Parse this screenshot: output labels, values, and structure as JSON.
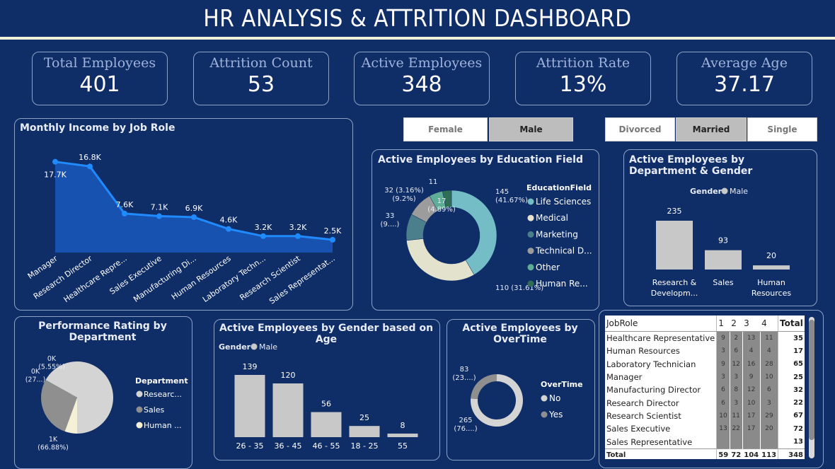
{
  "title": "HR ANALYSIS & ATTRITION DASHBOARD",
  "kpis": [
    {
      "label": "Total Employees",
      "value": "401"
    },
    {
      "label": "Attrition Count",
      "value": "53"
    },
    {
      "label": "Active Employees",
      "value": "348"
    },
    {
      "label": "Attrition Rate",
      "value": "13%"
    },
    {
      "label": "Average Age",
      "value": "37.17"
    }
  ],
  "slicers": {
    "gender": [
      {
        "label": "Female",
        "selected": false
      },
      {
        "label": "Male",
        "selected": true
      }
    ],
    "marital": [
      {
        "label": "Divorced",
        "selected": false
      },
      {
        "label": "Married",
        "selected": true
      },
      {
        "label": "Single",
        "selected": false
      }
    ]
  },
  "colors": {
    "background": "#0f2d66",
    "area": "#1a56b8",
    "line": "#1f8bff",
    "bar": "#c8c8c8"
  },
  "chart_data": [
    {
      "type": "area",
      "title": "Monthly Income by Job Role",
      "categories": [
        "Manager",
        "Research Director",
        "Healthcare Repre...",
        "Sales Executive",
        "Manufacturing Di...",
        "Human Resources",
        "Laboratory Techn...",
        "Research Scientist",
        "Sales Representat..."
      ],
      "values": [
        17.7,
        16.8,
        7.6,
        7.1,
        6.9,
        4.6,
        3.2,
        3.2,
        2.5
      ],
      "data_labels": [
        "17.7K",
        "16.8K",
        "7.6K",
        "7.1K",
        "6.9K",
        "4.6K",
        "3.2K",
        "3.2K",
        "2.5K"
      ],
      "ylim": [
        0,
        20
      ]
    },
    {
      "type": "pie",
      "title": "Active Employees by Education Field",
      "legend_title": "EducationField",
      "legend_position": "right",
      "slices": [
        {
          "name": "Life Sciences",
          "value": 145,
          "label": "145\n(41.67%)",
          "color": "#74bdc6"
        },
        {
          "name": "Medical",
          "value": 110,
          "label": "110 (31.61%)",
          "color": "#e3e2cc"
        },
        {
          "name": "Marketing",
          "value": 33,
          "label": "33\n(9....)",
          "color": "#4c7f8c"
        },
        {
          "name": "Technical D...",
          "value": 32,
          "label": "32 (3.16%)\n(9.2%)",
          "color": "#9c9c9c"
        },
        {
          "name": "Other",
          "value": 17,
          "label": "17\n(4.89%)",
          "color": "#5eae97"
        },
        {
          "name": "Human Re...",
          "value": 11,
          "label": "11",
          "color": "#2f6e55"
        }
      ]
    },
    {
      "type": "bar",
      "title": "Active Employees by Department & Gender",
      "legend_title": "Gender",
      "series": [
        {
          "name": "Male",
          "values": [
            235,
            93,
            20
          ]
        }
      ],
      "categories": [
        "Research & Developm...",
        "Sales",
        "Human Resources"
      ]
    },
    {
      "type": "pie",
      "title": "Performance Rating by Department",
      "legend_title": "Department",
      "slices": [
        {
          "name": "Researc...",
          "value": 66.88,
          "label": "1K\n(66.88%)",
          "color": "#d4d4d4"
        },
        {
          "name": "Sales",
          "value": 27.57,
          "label": "0K\n(27...)",
          "color": "#8f8f8f"
        },
        {
          "name": "Human ...",
          "value": 5.55,
          "label": "0K\n(5.55%)",
          "color": "#f5f1d7"
        }
      ]
    },
    {
      "type": "bar",
      "title": "Active Employees by Gender based on Age",
      "legend_title": "Gender",
      "series": [
        {
          "name": "Male",
          "values": [
            139,
            120,
            56,
            25,
            8
          ]
        }
      ],
      "categories": [
        "26 - 35",
        "36 - 45",
        "46 - 55",
        "18 - 25",
        "55"
      ]
    },
    {
      "type": "pie",
      "title": "Active Employees by OverTime",
      "legend_title": "OverTime",
      "slices": [
        {
          "name": "No",
          "value": 265,
          "label": "265\n(76....)",
          "color": "#d4d4d4"
        },
        {
          "name": "Yes",
          "value": 83,
          "label": "83\n(23....)",
          "color": "#8f8f8f"
        }
      ]
    },
    {
      "type": "table",
      "columns": [
        "JobRole",
        "1",
        "2",
        "3",
        "4",
        "Total"
      ],
      "rows": [
        [
          "Healthcare Representative",
          "9",
          "2",
          "13",
          "11",
          "35"
        ],
        [
          "Human Resources",
          "3",
          "6",
          "4",
          "4",
          "17"
        ],
        [
          "Laboratory Technician",
          "9",
          "12",
          "16",
          "28",
          "65"
        ],
        [
          "Manager",
          "3",
          "3",
          "9",
          "10",
          "25"
        ],
        [
          "Manufacturing Director",
          "6",
          "8",
          "12",
          "6",
          "32"
        ],
        [
          "Research Director",
          "6",
          "3",
          "10",
          "3",
          "22"
        ],
        [
          "Research Scientist",
          "10",
          "11",
          "17",
          "29",
          "67"
        ],
        [
          "Sales Executive",
          "13",
          "22",
          "17",
          "20",
          "72"
        ],
        [
          "Sales Representative",
          "",
          "",
          "",
          "",
          "13"
        ]
      ],
      "total_row": [
        "Total",
        "59",
        "72",
        "104",
        "113",
        "348"
      ]
    }
  ],
  "labels": {
    "income_title": "Monthly Income by Job Role",
    "edu_title": "Active Employees by Education Field",
    "edu_legend_title": "EducationField",
    "dept_title": "Active Employees by Department & Gender",
    "dept_legend_title": "Gender",
    "dept_legend_male": "Male",
    "perf_title": "Performance Rating by Department",
    "perf_legend_title": "Department",
    "age_title": "Active Employees by Gender based on Age",
    "age_legend_title": "Gender",
    "age_legend_male": "Male",
    "ot_title": "Active Employees by OverTime",
    "ot_legend_title": "OverTime"
  }
}
